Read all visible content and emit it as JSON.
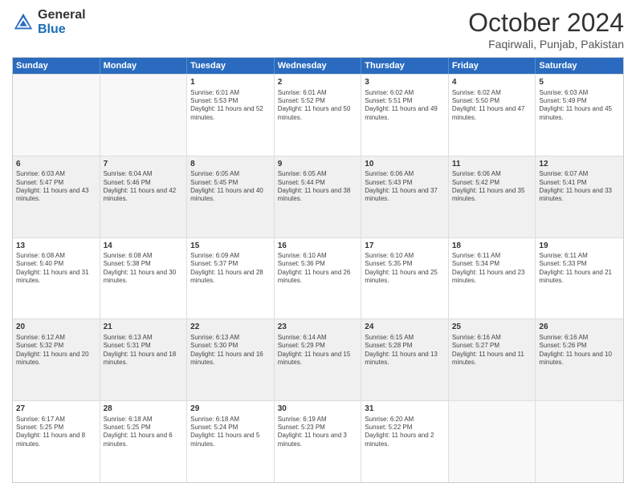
{
  "logo": {
    "line1": "General",
    "line2": "Blue"
  },
  "title": "October 2024",
  "location": "Faqirwali, Punjab, Pakistan",
  "days": [
    "Sunday",
    "Monday",
    "Tuesday",
    "Wednesday",
    "Thursday",
    "Friday",
    "Saturday"
  ],
  "weeks": [
    [
      {
        "day": "",
        "sunrise": "",
        "sunset": "",
        "daylight": "",
        "empty": true
      },
      {
        "day": "",
        "sunrise": "",
        "sunset": "",
        "daylight": "",
        "empty": true
      },
      {
        "day": "1",
        "sunrise": "Sunrise: 6:01 AM",
        "sunset": "Sunset: 5:53 PM",
        "daylight": "Daylight: 11 hours and 52 minutes."
      },
      {
        "day": "2",
        "sunrise": "Sunrise: 6:01 AM",
        "sunset": "Sunset: 5:52 PM",
        "daylight": "Daylight: 11 hours and 50 minutes."
      },
      {
        "day": "3",
        "sunrise": "Sunrise: 6:02 AM",
        "sunset": "Sunset: 5:51 PM",
        "daylight": "Daylight: 11 hours and 49 minutes."
      },
      {
        "day": "4",
        "sunrise": "Sunrise: 6:02 AM",
        "sunset": "Sunset: 5:50 PM",
        "daylight": "Daylight: 11 hours and 47 minutes."
      },
      {
        "day": "5",
        "sunrise": "Sunrise: 6:03 AM",
        "sunset": "Sunset: 5:49 PM",
        "daylight": "Daylight: 11 hours and 45 minutes."
      }
    ],
    [
      {
        "day": "6",
        "sunrise": "Sunrise: 6:03 AM",
        "sunset": "Sunset: 5:47 PM",
        "daylight": "Daylight: 11 hours and 43 minutes."
      },
      {
        "day": "7",
        "sunrise": "Sunrise: 6:04 AM",
        "sunset": "Sunset: 5:46 PM",
        "daylight": "Daylight: 11 hours and 42 minutes."
      },
      {
        "day": "8",
        "sunrise": "Sunrise: 6:05 AM",
        "sunset": "Sunset: 5:45 PM",
        "daylight": "Daylight: 11 hours and 40 minutes."
      },
      {
        "day": "9",
        "sunrise": "Sunrise: 6:05 AM",
        "sunset": "Sunset: 5:44 PM",
        "daylight": "Daylight: 11 hours and 38 minutes."
      },
      {
        "day": "10",
        "sunrise": "Sunrise: 6:06 AM",
        "sunset": "Sunset: 5:43 PM",
        "daylight": "Daylight: 11 hours and 37 minutes."
      },
      {
        "day": "11",
        "sunrise": "Sunrise: 6:06 AM",
        "sunset": "Sunset: 5:42 PM",
        "daylight": "Daylight: 11 hours and 35 minutes."
      },
      {
        "day": "12",
        "sunrise": "Sunrise: 6:07 AM",
        "sunset": "Sunset: 5:41 PM",
        "daylight": "Daylight: 11 hours and 33 minutes."
      }
    ],
    [
      {
        "day": "13",
        "sunrise": "Sunrise: 6:08 AM",
        "sunset": "Sunset: 5:40 PM",
        "daylight": "Daylight: 11 hours and 31 minutes."
      },
      {
        "day": "14",
        "sunrise": "Sunrise: 6:08 AM",
        "sunset": "Sunset: 5:38 PM",
        "daylight": "Daylight: 11 hours and 30 minutes."
      },
      {
        "day": "15",
        "sunrise": "Sunrise: 6:09 AM",
        "sunset": "Sunset: 5:37 PM",
        "daylight": "Daylight: 11 hours and 28 minutes."
      },
      {
        "day": "16",
        "sunrise": "Sunrise: 6:10 AM",
        "sunset": "Sunset: 5:36 PM",
        "daylight": "Daylight: 11 hours and 26 minutes."
      },
      {
        "day": "17",
        "sunrise": "Sunrise: 6:10 AM",
        "sunset": "Sunset: 5:35 PM",
        "daylight": "Daylight: 11 hours and 25 minutes."
      },
      {
        "day": "18",
        "sunrise": "Sunrise: 6:11 AM",
        "sunset": "Sunset: 5:34 PM",
        "daylight": "Daylight: 11 hours and 23 minutes."
      },
      {
        "day": "19",
        "sunrise": "Sunrise: 6:11 AM",
        "sunset": "Sunset: 5:33 PM",
        "daylight": "Daylight: 11 hours and 21 minutes."
      }
    ],
    [
      {
        "day": "20",
        "sunrise": "Sunrise: 6:12 AM",
        "sunset": "Sunset: 5:32 PM",
        "daylight": "Daylight: 11 hours and 20 minutes."
      },
      {
        "day": "21",
        "sunrise": "Sunrise: 6:13 AM",
        "sunset": "Sunset: 5:31 PM",
        "daylight": "Daylight: 11 hours and 18 minutes."
      },
      {
        "day": "22",
        "sunrise": "Sunrise: 6:13 AM",
        "sunset": "Sunset: 5:30 PM",
        "daylight": "Daylight: 11 hours and 16 minutes."
      },
      {
        "day": "23",
        "sunrise": "Sunrise: 6:14 AM",
        "sunset": "Sunset: 5:29 PM",
        "daylight": "Daylight: 11 hours and 15 minutes."
      },
      {
        "day": "24",
        "sunrise": "Sunrise: 6:15 AM",
        "sunset": "Sunset: 5:28 PM",
        "daylight": "Daylight: 11 hours and 13 minutes."
      },
      {
        "day": "25",
        "sunrise": "Sunrise: 6:16 AM",
        "sunset": "Sunset: 5:27 PM",
        "daylight": "Daylight: 11 hours and 11 minutes."
      },
      {
        "day": "26",
        "sunrise": "Sunrise: 6:16 AM",
        "sunset": "Sunset: 5:26 PM",
        "daylight": "Daylight: 11 hours and 10 minutes."
      }
    ],
    [
      {
        "day": "27",
        "sunrise": "Sunrise: 6:17 AM",
        "sunset": "Sunset: 5:25 PM",
        "daylight": "Daylight: 11 hours and 8 minutes."
      },
      {
        "day": "28",
        "sunrise": "Sunrise: 6:18 AM",
        "sunset": "Sunset: 5:25 PM",
        "daylight": "Daylight: 11 hours and 6 minutes."
      },
      {
        "day": "29",
        "sunrise": "Sunrise: 6:18 AM",
        "sunset": "Sunset: 5:24 PM",
        "daylight": "Daylight: 11 hours and 5 minutes."
      },
      {
        "day": "30",
        "sunrise": "Sunrise: 6:19 AM",
        "sunset": "Sunset: 5:23 PM",
        "daylight": "Daylight: 11 hours and 3 minutes."
      },
      {
        "day": "31",
        "sunrise": "Sunrise: 6:20 AM",
        "sunset": "Sunset: 5:22 PM",
        "daylight": "Daylight: 11 hours and 2 minutes."
      },
      {
        "day": "",
        "sunrise": "",
        "sunset": "",
        "daylight": "",
        "empty": true
      },
      {
        "day": "",
        "sunrise": "",
        "sunset": "",
        "daylight": "",
        "empty": true
      }
    ]
  ]
}
